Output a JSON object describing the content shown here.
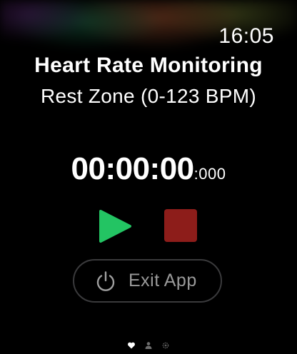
{
  "status_bar": {
    "time": "16:05"
  },
  "screen": {
    "title": "Heart Rate Monitoring",
    "zone": "Rest Zone (0-123 BPM)"
  },
  "timer": {
    "main": "00:00:00",
    "ms": ":000"
  },
  "controls": {
    "play_icon": "play-icon",
    "stop_icon": "stop-icon",
    "play_color": "#23c463",
    "stop_color": "#8d1d1a"
  },
  "exit_button": {
    "icon": "power-icon",
    "label": "Exit App"
  },
  "page_indicator": {
    "pages": [
      "heart-icon",
      "person-icon",
      "gear-icon"
    ],
    "active_index": 0
  }
}
